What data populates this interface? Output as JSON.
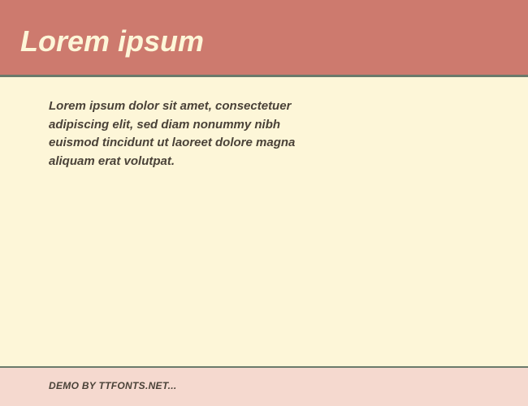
{
  "header": {
    "title": "Lorem ipsum"
  },
  "content": {
    "text": "Lorem ipsum dolor sit amet, consectetuer adipiscing elit, sed diam nonummy nibh euismod tincidunt ut laoreet dolore magna aliquam erat volutpat."
  },
  "footer": {
    "text": "DEMO BY TTFONTS.NET..."
  },
  "colors": {
    "header_bg": "#cd7a6e",
    "content_bg": "#fdf6d8",
    "footer_bg": "#f5d9cf",
    "border": "#6b7a6b",
    "title_text": "#fdf6d8",
    "body_text": "#4a4238"
  }
}
